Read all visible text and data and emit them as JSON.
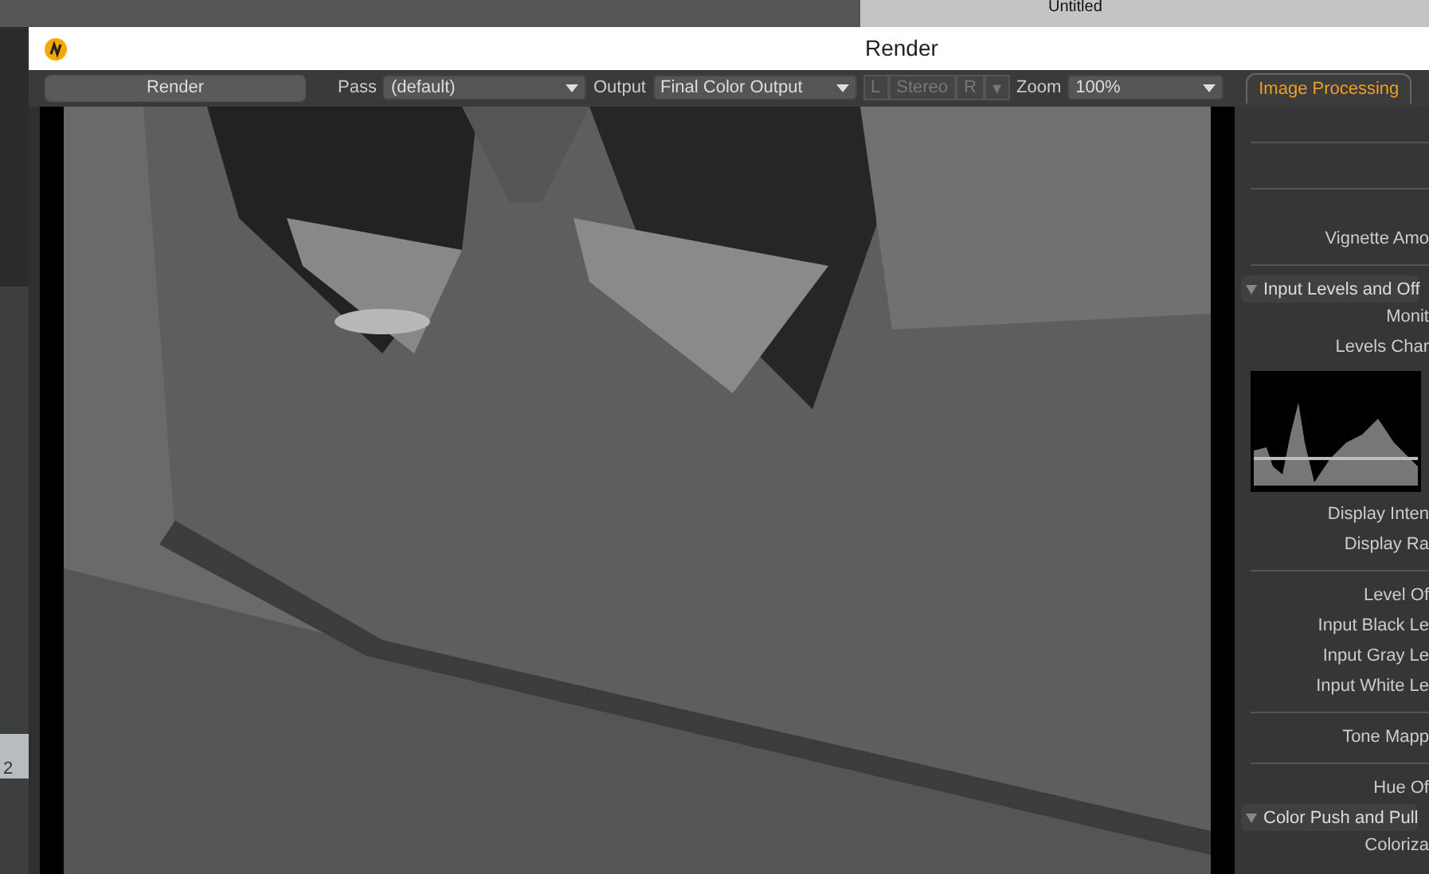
{
  "background": {
    "tree_item": "Untitled",
    "ruler_digit": "2"
  },
  "window": {
    "title": "Render"
  },
  "toolbar": {
    "render_button": "Render",
    "pass": {
      "label": "Pass",
      "value": "(default)"
    },
    "output": {
      "label": "Output",
      "value": "Final Color Output"
    },
    "stereo_buttons": [
      {
        "label": "L",
        "disabled": true
      },
      {
        "label": "Stereo",
        "disabled": true
      },
      {
        "label": "R",
        "disabled": true
      },
      {
        "label": "▾",
        "disabled": true
      }
    ],
    "zoom": {
      "label": "Zoom",
      "value": "100%"
    }
  },
  "tabs": [
    {
      "label": "Image Processing",
      "selected": true
    }
  ],
  "panel": [
    {
      "kind": "blank"
    },
    {
      "kind": "rule"
    },
    {
      "kind": "blank"
    },
    {
      "kind": "rule"
    },
    {
      "kind": "blank"
    },
    {
      "kind": "label",
      "text": "Vignette Amo"
    },
    {
      "kind": "rule"
    },
    {
      "kind": "section",
      "text": "Input Levels and Off",
      "expanded": true
    },
    {
      "kind": "label",
      "text": "Monit"
    },
    {
      "kind": "label",
      "text": "Levels Char"
    },
    {
      "kind": "histogram"
    },
    {
      "kind": "label",
      "text": "Display Inten"
    },
    {
      "kind": "label",
      "text": "Display Ra"
    },
    {
      "kind": "rule"
    },
    {
      "kind": "label",
      "text": "Level Of"
    },
    {
      "kind": "label",
      "text": "Input Black Le"
    },
    {
      "kind": "label",
      "text": "Input Gray Le"
    },
    {
      "kind": "label",
      "text": "Input White Le"
    },
    {
      "kind": "rule"
    },
    {
      "kind": "label",
      "text": "Tone Mapp"
    },
    {
      "kind": "rule"
    },
    {
      "kind": "label",
      "text": "Hue Of"
    },
    {
      "kind": "section",
      "text": "Color Push and Pull",
      "expanded": true
    },
    {
      "kind": "label",
      "text": "Coloriza"
    }
  ]
}
